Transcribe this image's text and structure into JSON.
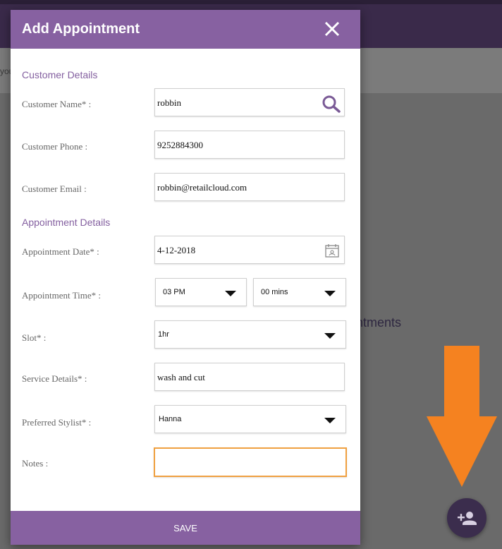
{
  "background": {
    "subbar_text": "you",
    "empty_text": "ntments",
    "fab_icon": "add-person-icon",
    "annotation_arrow_color": "#f58220"
  },
  "dialog": {
    "title": "Add Appointment",
    "close_icon": "close-icon",
    "sections": {
      "customer": "Customer Details",
      "appointment": "Appointment Details"
    },
    "fields": {
      "customer_name": {
        "label": "Customer Name* :",
        "value": "robbin"
      },
      "customer_phone": {
        "label": "Customer Phone :",
        "value": "9252884300"
      },
      "customer_email": {
        "label": "Customer Email :",
        "value": "robbin@retailcloud.com"
      },
      "appointment_date": {
        "label": "Appointment Date* :",
        "value": "4-12-2018"
      },
      "appointment_time": {
        "label": "Appointment Time* :",
        "hour": "03 PM",
        "minutes": "00 mins"
      },
      "slot": {
        "label": "Slot* :",
        "value": "1hr"
      },
      "service_details": {
        "label": "Service Details* :",
        "value": "wash and cut"
      },
      "preferred_stylist": {
        "label": "Preferred Stylist* :",
        "value": "Hanna"
      },
      "notes": {
        "label": "Notes :",
        "value": ""
      }
    },
    "save_label": "SAVE"
  },
  "colors": {
    "header": "#8761a1",
    "section_text": "#8460a0",
    "focus_border": "#f0a040",
    "topbar": "#3a2a4a"
  }
}
